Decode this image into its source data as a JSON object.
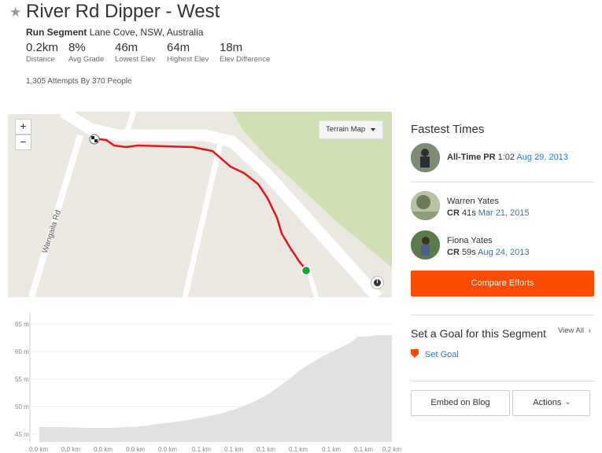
{
  "header": {
    "title": "River Rd Dipper - West",
    "activity_type": "Run Segment",
    "location": "Lane Cove, NSW, Australia",
    "stats": [
      {
        "value": "0.2km",
        "label": "Distance"
      },
      {
        "value": "8%",
        "label": "Avg Grade"
      },
      {
        "value": "46m",
        "label": "Lowest Elev"
      },
      {
        "value": "64m",
        "label": "Highest Elev"
      },
      {
        "value": "18m",
        "label": "Elev Difference"
      }
    ],
    "attempts": "1,305 Attempts By 370 People"
  },
  "map": {
    "zoom_in": "+",
    "zoom_out": "−",
    "layer_label": "Terrain Map",
    "road_label": "Wangaila Rd",
    "info": "i",
    "route_color": "#e8141a",
    "start_color": "#1aa136"
  },
  "elevation": {
    "y_labels": [
      "65 m",
      "60 m",
      "55 m",
      "50 m",
      "45 m"
    ],
    "x_labels": [
      "0.0 km",
      "0.0 km",
      "0.0 km",
      "0.0 km",
      "0.0 km",
      "0.1 km",
      "0.1 km",
      "0.1 km",
      "0.1 km",
      "0.1 km",
      "0.1 km",
      "0.2 km"
    ]
  },
  "fastest": {
    "title": "Fastest Times",
    "pr": {
      "label": "All-Time PR",
      "time": "1:02",
      "date": "Aug 29, 2013"
    },
    "records": [
      {
        "name": "Warren Yates",
        "badge": "CR",
        "time": "41s",
        "date": "Mar 21, 2015"
      },
      {
        "name": "Fiona Yates",
        "badge": "CR",
        "time": "59s",
        "date": "Aug 24, 2013"
      }
    ],
    "compare_label": "Compare Efforts"
  },
  "goal": {
    "title": "Set a Goal for this Segment",
    "view_all": "View All",
    "set_goal": "Set Goal"
  },
  "actions": {
    "embed": "Embed on Blog",
    "actions": "Actions"
  },
  "colors": {
    "accent": "#fc4c02",
    "link": "#2a79be"
  }
}
